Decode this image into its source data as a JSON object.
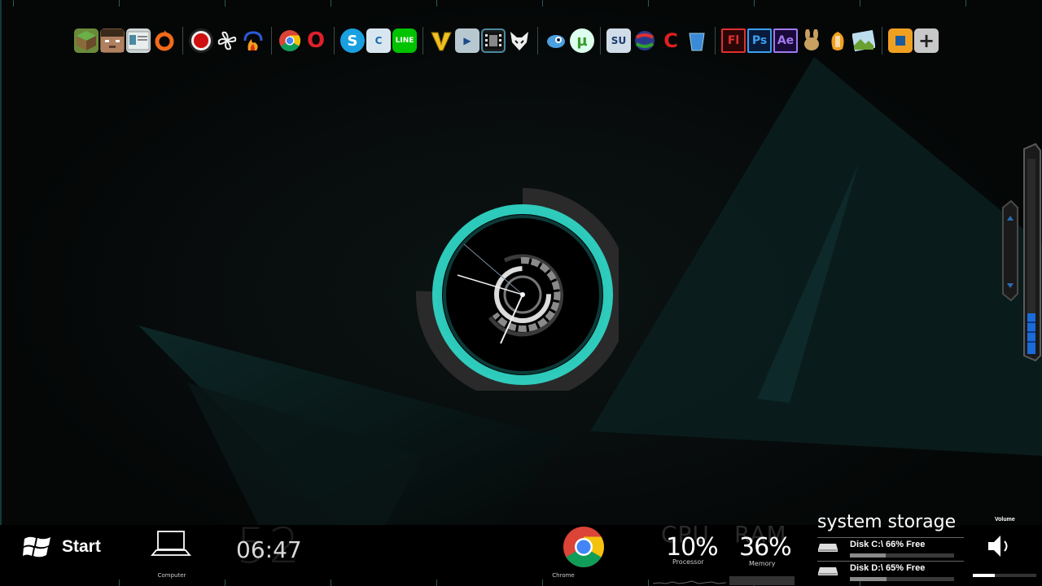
{
  "dock": {
    "groups": [
      [
        {
          "name": "minecraft",
          "label": "",
          "bg": "#6a8a3a",
          "fg": "#fff"
        },
        {
          "name": "steve",
          "label": "",
          "bg": "#7a5a3a",
          "fg": "#fff"
        },
        {
          "name": "app-window",
          "label": "",
          "bg": "#cfd6d6",
          "fg": "#333"
        },
        {
          "name": "origin",
          "label": "",
          "bg": "transparent",
          "fg": "#f26a1b"
        }
      ],
      [
        {
          "name": "record",
          "label": "",
          "bg": "#222",
          "fg": "#d01010"
        },
        {
          "name": "fan",
          "label": "",
          "bg": "transparent",
          "fg": "#eee"
        },
        {
          "name": "audio-flame",
          "label": "",
          "bg": "transparent",
          "fg": "#f0a020"
        }
      ],
      [
        {
          "name": "chrome",
          "label": "",
          "bg": "transparent",
          "fg": "#fff"
        },
        {
          "name": "opera",
          "label": "O",
          "bg": "transparent",
          "fg": "#e0202a"
        }
      ],
      [
        {
          "name": "skype",
          "label": "S",
          "bg": "#1aa0e0",
          "fg": "#fff"
        },
        {
          "name": "c-app",
          "label": "C",
          "bg": "#d8e6f0",
          "fg": "#1a6ab0"
        },
        {
          "name": "line",
          "label": "LINE",
          "bg": "#00c300",
          "fg": "#fff"
        }
      ],
      [
        {
          "name": "v-app",
          "label": "V",
          "bg": "transparent",
          "fg": "#f0c020"
        },
        {
          "name": "player",
          "label": "▶",
          "bg": "#b8c8d0",
          "fg": "#1a4a8a"
        },
        {
          "name": "film",
          "label": "",
          "bg": "#1a1a1a",
          "fg": "#ddd"
        },
        {
          "name": "fox",
          "label": "",
          "bg": "transparent",
          "fg": "#eee"
        }
      ],
      [
        {
          "name": "bird",
          "label": "",
          "bg": "transparent",
          "fg": "#4aa0e0"
        },
        {
          "name": "utorrent",
          "label": "µ",
          "bg": "#dfe",
          "fg": "#3a9a2a"
        }
      ],
      [
        {
          "name": "su",
          "label": "SU",
          "bg": "#d0dce8",
          "fg": "#1a3a6a"
        },
        {
          "name": "globe",
          "label": "",
          "bg": "transparent",
          "fg": "#d02a2a"
        },
        {
          "name": "ccleaner",
          "label": "C",
          "bg": "transparent",
          "fg": "#e02020"
        },
        {
          "name": "bucket",
          "label": "",
          "bg": "transparent",
          "fg": "#3a8ad8"
        }
      ],
      [
        {
          "name": "flash",
          "label": "Fl",
          "bg": "#2a0606",
          "fg": "#e03030"
        },
        {
          "name": "photoshop",
          "label": "Ps",
          "bg": "#0a1a3a",
          "fg": "#3aa0f0"
        },
        {
          "name": "after-effects",
          "label": "Ae",
          "bg": "#1a0a3a",
          "fg": "#a07af0"
        },
        {
          "name": "rabbit",
          "label": "",
          "bg": "transparent",
          "fg": "#c8a060"
        },
        {
          "name": "fruity-loops",
          "label": "",
          "bg": "transparent",
          "fg": "#f0a020"
        },
        {
          "name": "landscape",
          "label": "",
          "bg": "transparent",
          "fg": "#8ac040"
        }
      ],
      [
        {
          "name": "virtualbox",
          "label": "",
          "bg": "#f0a020",
          "fg": "#1a5aa0"
        },
        {
          "name": "add",
          "label": "+",
          "bg": "#c8c8c8",
          "fg": "#222"
        }
      ]
    ]
  },
  "taskbar": {
    "start_label": "Start",
    "computer_label": "Computer",
    "clock_seconds": "52",
    "clock_time": "06:47",
    "chrome_label": "Chrome",
    "cpu_word": "CPU",
    "ram_word": "RAM",
    "cpu_value": "10%",
    "cpu_label": "Processor",
    "ram_value": "36%",
    "ram_label": "Memory",
    "storage_title": "system storage",
    "disks": [
      {
        "text": "Disk C:\\ 66% Free",
        "free_fraction": 0.66
      },
      {
        "text": "Disk D:\\ 65% Free",
        "free_fraction": 0.65
      }
    ],
    "volume_label": "Volume",
    "volume_level": 0.35
  },
  "accent": "#2fd4c4"
}
